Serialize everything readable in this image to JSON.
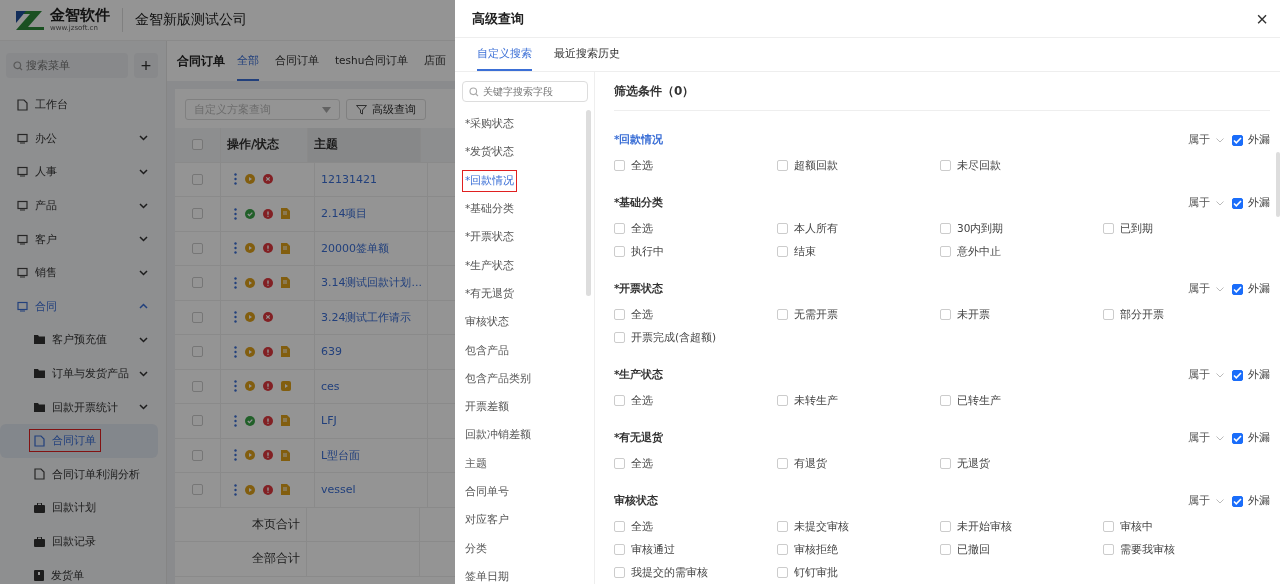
{
  "app": {
    "logo": {
      "name": "金智软件",
      "url": "www.jzsoft.cn"
    },
    "company": "金智新版测试公司"
  },
  "sidebar": {
    "search": {
      "placeholder": "搜索菜单"
    },
    "add": "+",
    "items": [
      {
        "label": "工作台",
        "kind": "page",
        "selected": false,
        "annotated": false
      },
      {
        "label": "办公",
        "kind": "group",
        "expanded": false,
        "selected": false,
        "annotated": false
      },
      {
        "label": "人事",
        "kind": "group",
        "expanded": false,
        "selected": false,
        "annotated": false
      },
      {
        "label": "产品",
        "kind": "group",
        "expanded": false,
        "selected": false,
        "annotated": false
      },
      {
        "label": "客户",
        "kind": "group",
        "expanded": false,
        "selected": false,
        "annotated": false
      },
      {
        "label": "销售",
        "kind": "group",
        "expanded": false,
        "selected": false,
        "annotated": false
      },
      {
        "label": "合同",
        "kind": "group",
        "expanded": true,
        "selected": false,
        "annotated": false,
        "children": [
          {
            "label": "客户预充值",
            "kind": "group",
            "expanded": false,
            "selected": false,
            "annotated": false
          },
          {
            "label": "订单与发货产品",
            "kind": "group",
            "expanded": false,
            "selected": false,
            "annotated": false
          },
          {
            "label": "回款开票统计",
            "kind": "group",
            "expanded": false,
            "selected": false,
            "annotated": false
          },
          {
            "label": "合同订单",
            "kind": "page",
            "selected": true,
            "annotated": true
          },
          {
            "label": "合同订单利润分析",
            "kind": "page",
            "selected": false,
            "annotated": false
          },
          {
            "label": "回款计划",
            "kind": "report",
            "selected": false,
            "annotated": false
          },
          {
            "label": "回款记录",
            "kind": "report",
            "selected": false,
            "annotated": false
          },
          {
            "label": "发货单",
            "kind": "box",
            "selected": false,
            "annotated": false
          }
        ]
      }
    ]
  },
  "main": {
    "title": "合同订单",
    "tabs": [
      {
        "label": "全部",
        "selected": true
      },
      {
        "label": "合同订单",
        "selected": false
      },
      {
        "label": "teshu合同订单",
        "selected": false
      },
      {
        "label": "店面",
        "selected": false
      }
    ],
    "scheme_select": {
      "placeholder": "自定义方案查询"
    },
    "advanced_button": "高级查询",
    "table": {
      "all_checked": false,
      "columns": [
        "操作/状态",
        "主题"
      ],
      "rows": [
        {
          "checked": false,
          "icons": [
            {
              "kind": "running"
            },
            {
              "kind": "rejected"
            }
          ],
          "subject": "12131421"
        },
        {
          "checked": false,
          "icons": [
            {
              "kind": "done"
            },
            {
              "kind": "warning"
            },
            {
              "kind": "file"
            }
          ],
          "subject": "2.14项目"
        },
        {
          "checked": false,
          "icons": [
            {
              "kind": "running"
            },
            {
              "kind": "warning"
            },
            {
              "kind": "file"
            }
          ],
          "subject": "20000签单额"
        },
        {
          "checked": false,
          "icons": [
            {
              "kind": "running"
            },
            {
              "kind": "warning"
            },
            {
              "kind": "file"
            }
          ],
          "subject": "3.14测试回款计划..."
        },
        {
          "checked": false,
          "icons": [
            {
              "kind": "running"
            },
            {
              "kind": "rejected"
            }
          ],
          "subject": "3.24测试工作请示"
        },
        {
          "checked": false,
          "icons": [
            {
              "kind": "running"
            },
            {
              "kind": "warning"
            },
            {
              "kind": "file"
            }
          ],
          "subject": "639"
        },
        {
          "checked": false,
          "icons": [
            {
              "kind": "running"
            },
            {
              "kind": "warning"
            },
            {
              "kind": "media"
            }
          ],
          "subject": "ces"
        },
        {
          "checked": false,
          "icons": [
            {
              "kind": "done"
            },
            {
              "kind": "warning"
            },
            {
              "kind": "file"
            }
          ],
          "subject": "LFJ"
        },
        {
          "checked": false,
          "icons": [
            {
              "kind": "running"
            },
            {
              "kind": "warning"
            },
            {
              "kind": "file"
            }
          ],
          "subject": "L型台面"
        },
        {
          "checked": false,
          "icons": [
            {
              "kind": "running"
            },
            {
              "kind": "warning"
            },
            {
              "kind": "file"
            }
          ],
          "subject": "vessel"
        }
      ],
      "totals": [
        "本页合计",
        "全部合计"
      ]
    }
  },
  "drawer": {
    "title": "高级查询",
    "close": "×",
    "tabs": [
      {
        "label": "自定义搜索",
        "selected": true
      },
      {
        "label": "最近搜索历史",
        "selected": false
      }
    ],
    "field_search": {
      "placeholder": "关键字搜索字段"
    },
    "fields": [
      {
        "label": "*采购状态",
        "selected": false,
        "annotated": false
      },
      {
        "label": "*发货状态",
        "selected": false,
        "annotated": false
      },
      {
        "label": "*回款情况",
        "selected": true,
        "annotated": true
      },
      {
        "label": "*基础分类",
        "selected": false,
        "annotated": false
      },
      {
        "label": "*开票状态",
        "selected": false,
        "annotated": false
      },
      {
        "label": "*生产状态",
        "selected": false,
        "annotated": false
      },
      {
        "label": "*有无退货",
        "selected": false,
        "annotated": false
      },
      {
        "label": "审核状态",
        "selected": false,
        "annotated": false
      },
      {
        "label": "包含产品",
        "selected": false,
        "annotated": false
      },
      {
        "label": "包含产品类别",
        "selected": false,
        "annotated": false
      },
      {
        "label": "开票差额",
        "selected": false,
        "annotated": false
      },
      {
        "label": "回款冲销差额",
        "selected": false,
        "annotated": false
      },
      {
        "label": "主题",
        "selected": false,
        "annotated": false
      },
      {
        "label": "合同单号",
        "selected": false,
        "annotated": false
      },
      {
        "label": "对应客户",
        "selected": false,
        "annotated": false
      },
      {
        "label": "分类",
        "selected": false,
        "annotated": false
      },
      {
        "label": "签单日期",
        "selected": false,
        "annotated": false
      }
    ],
    "conditions_title": "筛选条件（0）",
    "groups": [
      {
        "title": "*回款情况",
        "active": true,
        "operator": "属于",
        "exclude": {
          "label": "外漏",
          "checked": true
        },
        "options": [
          {
            "label": "全选",
            "checked": false
          },
          {
            "label": "超额回款",
            "checked": false
          },
          {
            "label": "未尽回款",
            "checked": false
          }
        ]
      },
      {
        "title": "*基础分类",
        "active": false,
        "operator": "属于",
        "exclude": {
          "label": "外漏",
          "checked": true
        },
        "options": [
          {
            "label": "全选",
            "checked": false
          },
          {
            "label": "本人所有",
            "checked": false
          },
          {
            "label": "30内到期",
            "checked": false
          },
          {
            "label": "已到期",
            "checked": false
          },
          {
            "label": "执行中",
            "checked": false
          },
          {
            "label": "结束",
            "checked": false
          },
          {
            "label": "意外中止",
            "checked": false
          }
        ]
      },
      {
        "title": "*开票状态",
        "active": false,
        "operator": "属于",
        "exclude": {
          "label": "外漏",
          "checked": true
        },
        "options": [
          {
            "label": "全选",
            "checked": false
          },
          {
            "label": "无需开票",
            "checked": false
          },
          {
            "label": "未开票",
            "checked": false
          },
          {
            "label": "部分开票",
            "checked": false
          },
          {
            "label": "开票完成(含超额)",
            "checked": false
          }
        ]
      },
      {
        "title": "*生产状态",
        "active": false,
        "operator": "属于",
        "exclude": {
          "label": "外漏",
          "checked": true
        },
        "options": [
          {
            "label": "全选",
            "checked": false
          },
          {
            "label": "未转生产",
            "checked": false
          },
          {
            "label": "已转生产",
            "checked": false
          }
        ]
      },
      {
        "title": "*有无退货",
        "active": false,
        "operator": "属于",
        "exclude": {
          "label": "外漏",
          "checked": true
        },
        "options": [
          {
            "label": "全选",
            "checked": false
          },
          {
            "label": "有退货",
            "checked": false
          },
          {
            "label": "无退货",
            "checked": false
          }
        ]
      },
      {
        "title": "审核状态",
        "active": false,
        "operator": "属于",
        "exclude": {
          "label": "外漏",
          "checked": true
        },
        "options": [
          {
            "label": "全选",
            "checked": false
          },
          {
            "label": "未提交审核",
            "checked": false
          },
          {
            "label": "未开始审核",
            "checked": false
          },
          {
            "label": "审核中",
            "checked": false
          },
          {
            "label": "审核通过",
            "checked": false
          },
          {
            "label": "审核拒绝",
            "checked": false
          },
          {
            "label": "已撤回",
            "checked": false
          },
          {
            "label": "需要我审核",
            "checked": false
          },
          {
            "label": "我提交的需审核",
            "checked": false
          },
          {
            "label": "钉钉审批",
            "checked": false
          }
        ]
      }
    ]
  }
}
